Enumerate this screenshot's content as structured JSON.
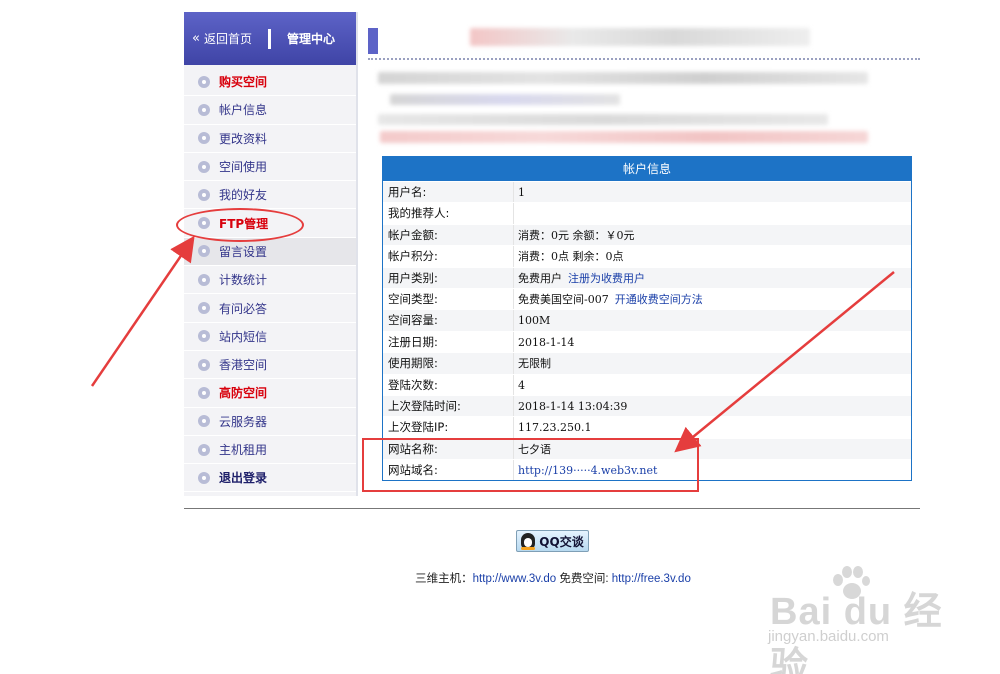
{
  "sidebar": {
    "back_home": "返回首页",
    "admin_center": "管理中心",
    "items": [
      {
        "label": "购买空间",
        "style": "red"
      },
      {
        "label": "帐户信息",
        "style": "normal"
      },
      {
        "label": "更改资料",
        "style": "normal"
      },
      {
        "label": "空间使用",
        "style": "normal"
      },
      {
        "label": "我的好友",
        "style": "normal"
      },
      {
        "label": "FTP管理",
        "style": "red"
      },
      {
        "label": "留言设置",
        "style": "normal",
        "active": true
      },
      {
        "label": "计数统计",
        "style": "normal"
      },
      {
        "label": "有问必答",
        "style": "normal"
      },
      {
        "label": "站内短信",
        "style": "normal"
      },
      {
        "label": "香港空间",
        "style": "normal"
      },
      {
        "label": "高防空间",
        "style": "red"
      },
      {
        "label": "云服务器",
        "style": "normal"
      },
      {
        "label": "主机租用",
        "style": "normal"
      },
      {
        "label": "退出登录",
        "style": "bold"
      }
    ]
  },
  "account": {
    "title": "帐户信息",
    "rows": [
      {
        "label": "用户名:",
        "value": "1"
      },
      {
        "label": "我的推荐人:",
        "value": ""
      },
      {
        "label": "帐户金额:",
        "value": "消费：0元 余额：￥0元"
      },
      {
        "label": "帐户积分:",
        "value": "消费：0点 剩余：0点"
      },
      {
        "label": "用户类别:",
        "value": "免费用户",
        "link": "注册为收费用户"
      },
      {
        "label": "空间类型:",
        "value": "免费美国空间-007",
        "link": "开通收费空间方法"
      },
      {
        "label": "空间容量:",
        "value": "100M"
      },
      {
        "label": "注册日期:",
        "value": "2018-1-14"
      },
      {
        "label": "使用期限:",
        "value": "无限制"
      },
      {
        "label": "登陆次数:",
        "value": "4"
      },
      {
        "label": "上次登陆时间:",
        "value": "2018-1-14 13:04:39"
      },
      {
        "label": "上次登陆IP:",
        "value": "117.23.250.1"
      },
      {
        "label": "网站名称:",
        "value": "七夕语"
      },
      {
        "label": "网站域名:",
        "value": "http://139·····4.web3v.net",
        "is_url": true
      }
    ]
  },
  "footer": {
    "qq_button": "QQ交谈",
    "prefix": "三维主机：",
    "host_url": "http://www.3v.do",
    "free_label": " 免费空间: ",
    "free_url": "http://free.3v.do"
  },
  "watermark": {
    "logo": "Bai du 经验",
    "url": "jingyan.baidu.com"
  },
  "colors": {
    "header_blue": "#4a50b5",
    "table_blue": "#1d73c6",
    "link_blue": "#1a3fa8",
    "highlight_red": "#e53d3d",
    "menu_red": "#d8000c"
  },
  "icons": [
    "chevron-double-left-icon",
    "menu-bullet-icon",
    "qq-penguin-icon",
    "baidu-paw-icon"
  ]
}
